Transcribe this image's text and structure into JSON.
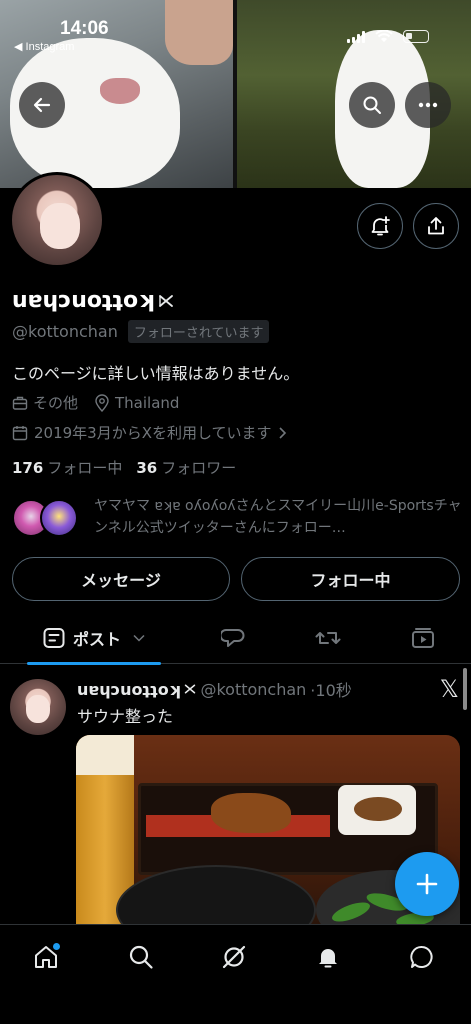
{
  "status_bar": {
    "time": "14:06",
    "back_app": "◀ Instagram"
  },
  "profile": {
    "display_name": "uɐɥɔuoʇʇoʞ",
    "handle": "@kottonchan",
    "follows_you_badge": "フォローされています",
    "bio": "このページに詳しい情報はありません。",
    "category": "その他",
    "location": "Thailand",
    "joined": "2019年3月からXを利用しています",
    "following_count": "176",
    "following_label": "フォロー中",
    "followers_count": "36",
    "followers_label": "フォロワー",
    "followed_by_text": "ヤマヤマ ɐʞɐ oʎoʎoʎさんとスマイリー山川e-Sportsチャンネル公式ツイッターさんにフォロー…"
  },
  "actions": {
    "message_label": "メッセージ",
    "following_label": "フォロー中"
  },
  "tabs": {
    "posts_label": "ポスト"
  },
  "tweet": {
    "name": "uɐɥɔuoʇʇoʞ",
    "handle": "@kottonchan",
    "time": "·10秒",
    "text": "サウナ整った"
  },
  "colors": {
    "accent": "#1d9bf0",
    "background": "#000000",
    "muted": "#71767b",
    "border": "#536471"
  },
  "icons": [
    "back-arrow-icon",
    "search-icon",
    "more-icon",
    "bell-plus-icon",
    "share-icon",
    "verified-x-icon",
    "briefcase-icon",
    "location-pin-icon",
    "calendar-icon",
    "chevron-right-icon",
    "list-icon",
    "chevron-down-icon",
    "reply-icon",
    "repost-icon",
    "media-icon",
    "x-logo-icon",
    "plus-icon",
    "home-icon",
    "grok-icon",
    "bell-icon",
    "chat-icon"
  ]
}
